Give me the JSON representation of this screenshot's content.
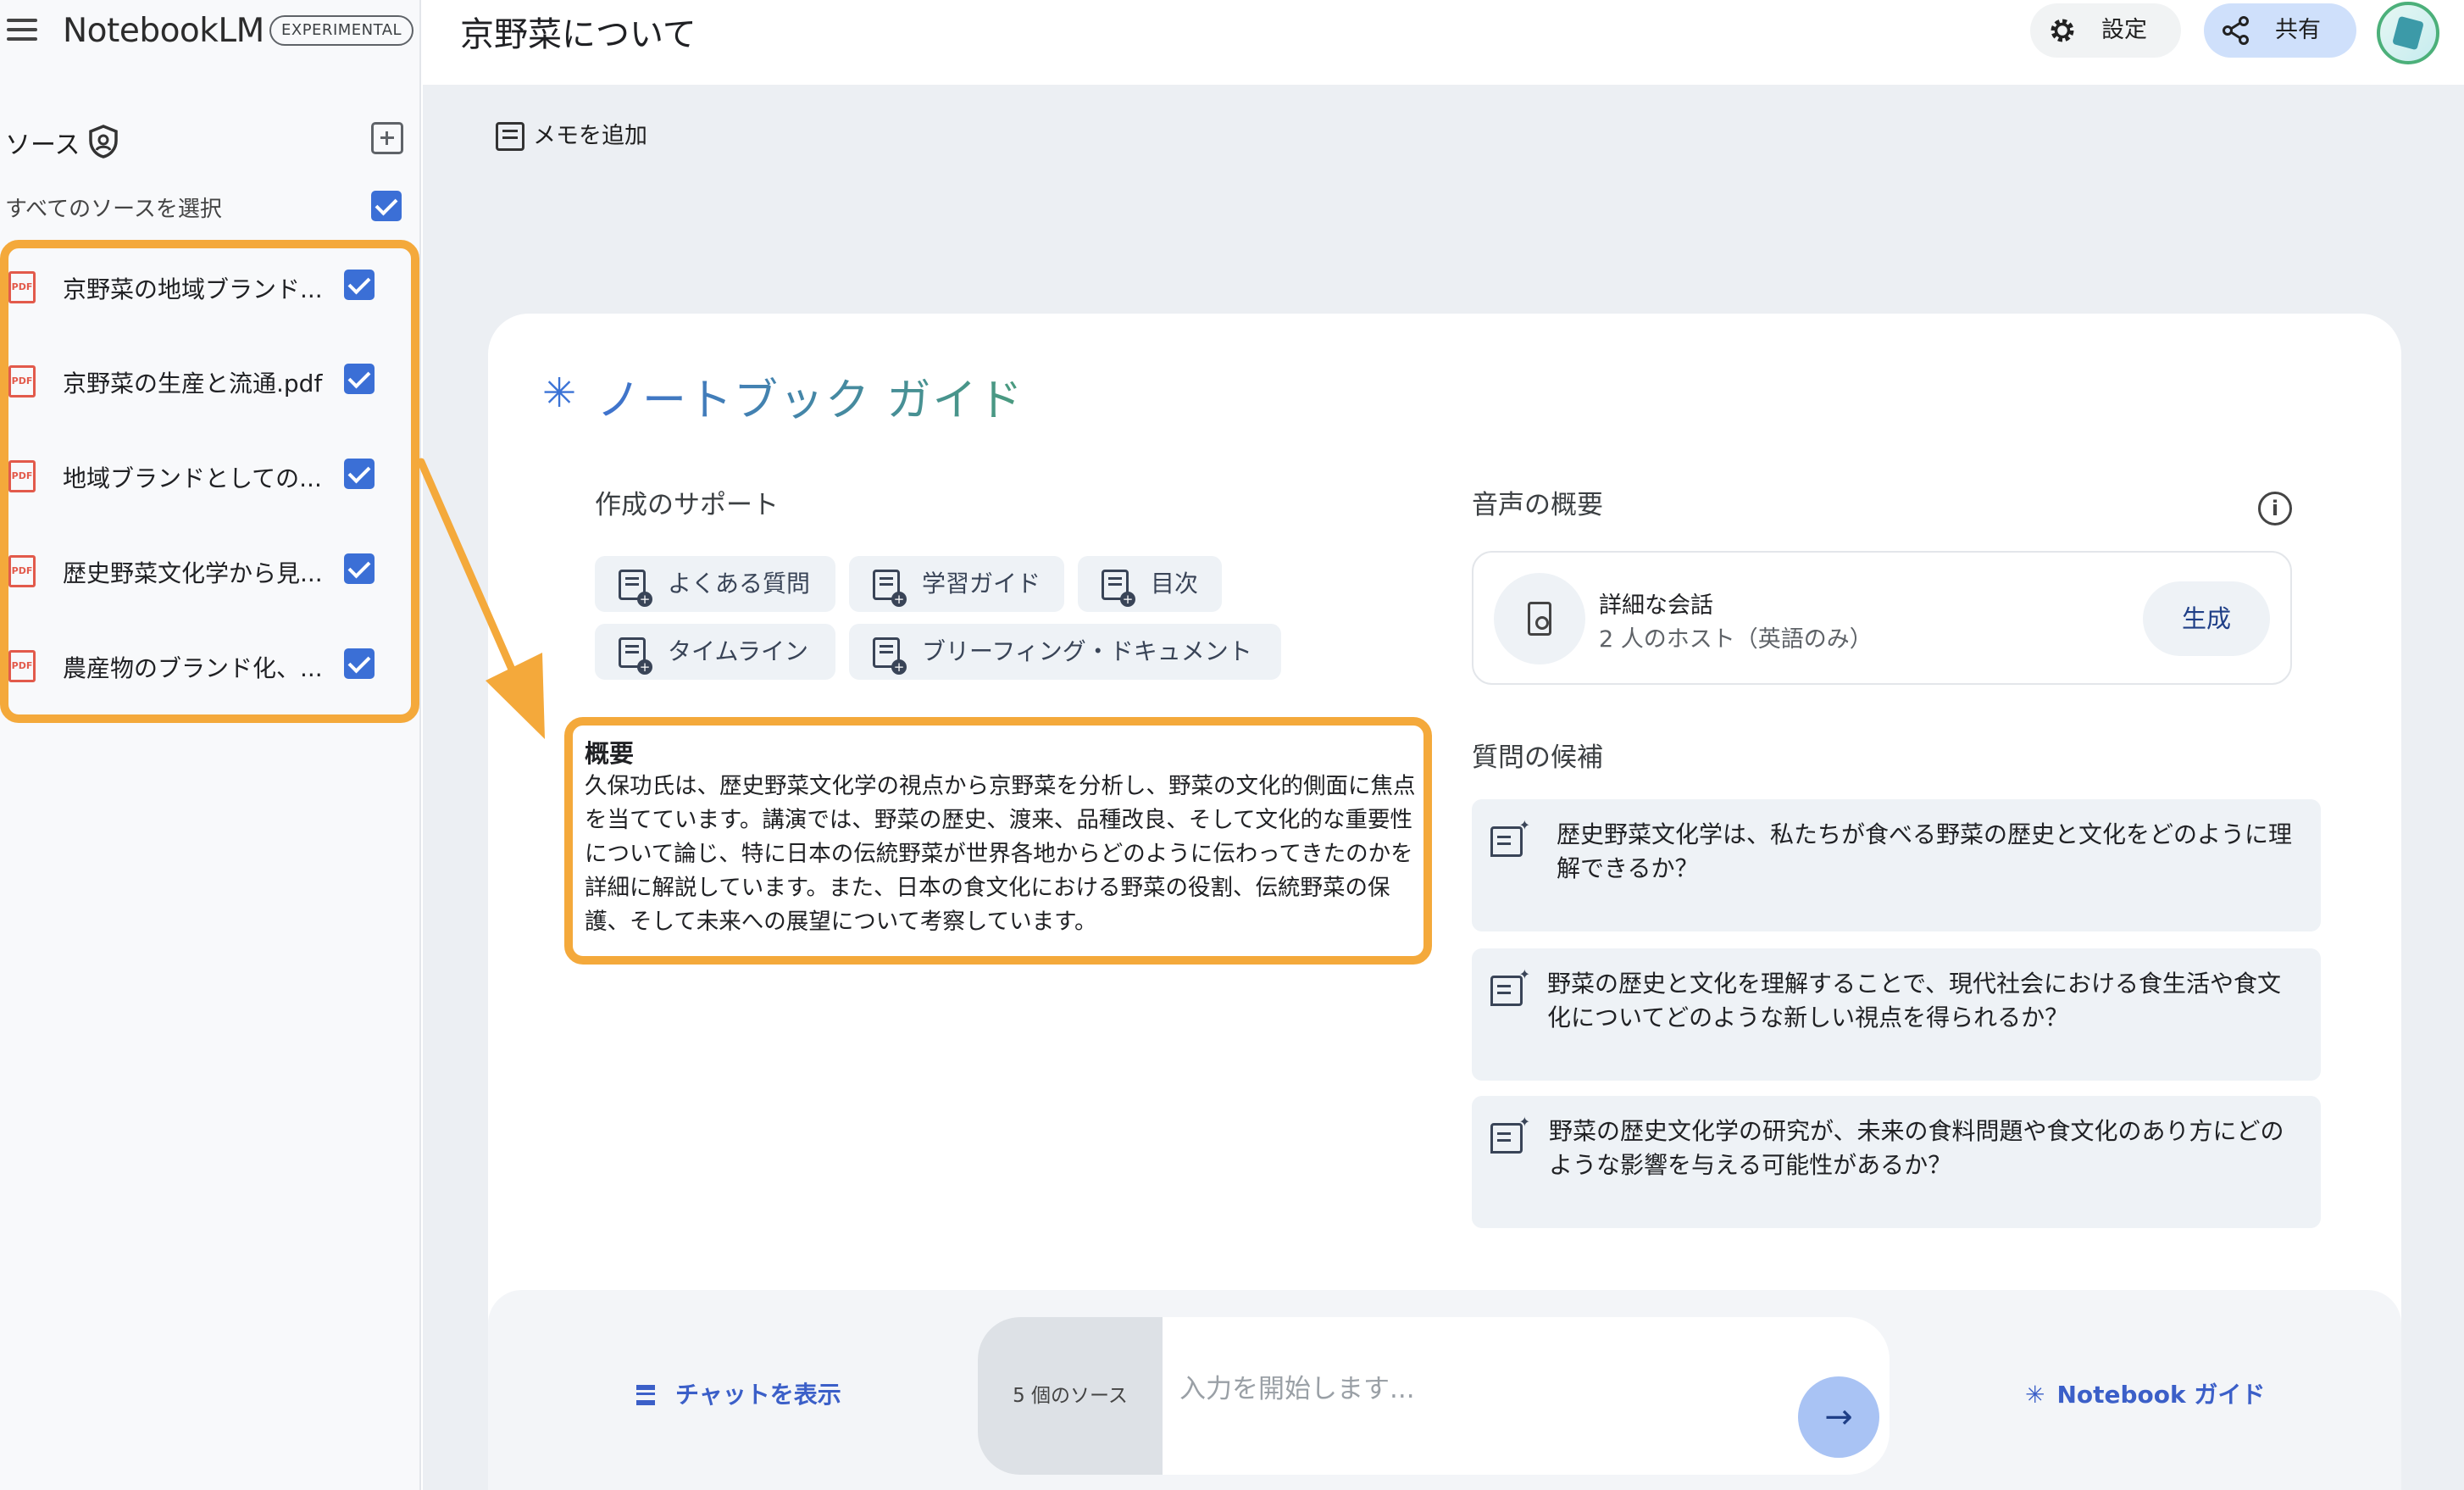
{
  "header": {
    "logo_text": "NotebookLM",
    "badge": "EXPERIMENTAL",
    "notebook_title": "京野菜について",
    "settings_label": "設定",
    "share_label": "共有"
  },
  "sidebar": {
    "title": "ソース",
    "select_all_label": "すべてのソースを選択",
    "pdf_badge": "PDF",
    "sources": [
      {
        "label": "京野菜の地域ブランド..."
      },
      {
        "label": "京野菜の生産と流通.pdf"
      },
      {
        "label": "地域ブランドとしての..."
      },
      {
        "label": "歴史野菜文化学から見..."
      },
      {
        "label": "農産物のブランド化、..."
      }
    ]
  },
  "main": {
    "memo_label": "メモを追加",
    "guide": {
      "star": "✳",
      "title": "ノートブック ガイド",
      "support_title": "作成のサポート",
      "chips": [
        {
          "label": "よくある質問"
        },
        {
          "label": "学習ガイド"
        },
        {
          "label": "目次"
        },
        {
          "label": "タイムライン"
        },
        {
          "label": "ブリーフィング・ドキュメント"
        }
      ],
      "summary_title": "概要",
      "summary_text": "久保功氏は、歴史野菜文化学の視点から京野菜を分析し、野菜の文化的側面に焦点を当てています。講演では、野菜の歴史、渡来、品種改良、そして文化的な重要性について論じ、特に日本の伝統野菜が世界各地からどのように伝わってきたのかを詳細に解説しています。また、日本の食文化における野菜の役割、伝統野菜の保護、そして未来への展望について考察しています。",
      "audio_title": "音声の概要",
      "audio_card_title": "詳細な会話",
      "audio_card_sub": "2 人のホスト（英語のみ）",
      "generate_label": "生成",
      "questions_title": "質問の候補",
      "questions": [
        {
          "text": "歴史野菜文化学は、私たちが食べる野菜の歴史と文化をどのように理解できるか？"
        },
        {
          "text": "野菜の歴史と文化を理解することで、現代社会における食生活や食文化についてどのような新しい視点を得られるか？"
        },
        {
          "text": "野菜の歴史文化学の研究が、未来の食料問題や食文化のあり方にどのような影響を与える可能性があるか？"
        }
      ]
    }
  },
  "bottom": {
    "chat_label": "チャットを表示",
    "source_count": "5 個のソース",
    "input_placeholder": "入力を開始します...",
    "guide_star": "✳",
    "guide_label": "Notebook ガイド"
  },
  "colors": {
    "accent": "#3b6fd6",
    "highlight": "#f4a93b",
    "pdf_red": "#e25a4b"
  }
}
